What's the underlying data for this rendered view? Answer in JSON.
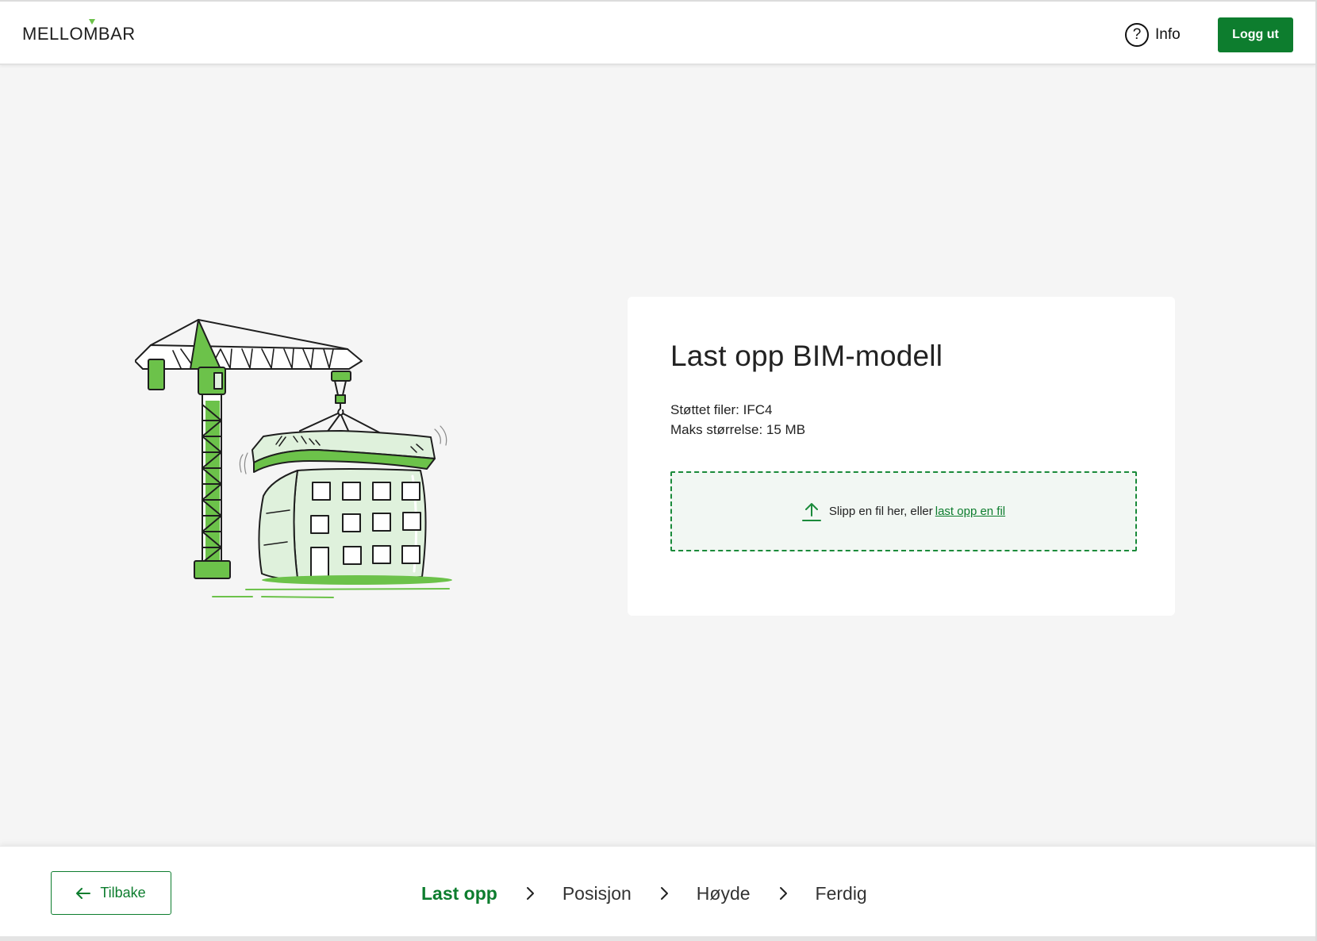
{
  "header": {
    "logo": "MELLOMBAR",
    "info_label": "Info",
    "logout_label": "Logg ut"
  },
  "card": {
    "title": "Last opp BIM-modell",
    "supported_files": "Støttet filer: IFC4",
    "max_size": "Maks størrelse: 15 MB",
    "dropzone_text": "Slipp en fil her, eller",
    "dropzone_link": "last opp en fil"
  },
  "footer": {
    "back_label": "Tilbake",
    "steps": [
      {
        "label": "Last opp",
        "active": true
      },
      {
        "label": "Posisjon",
        "active": false
      },
      {
        "label": "Høyde",
        "active": false
      },
      {
        "label": "Ferdig",
        "active": false
      }
    ]
  },
  "colors": {
    "brand_green": "#0d7d2e",
    "light_green": "#6cc24a",
    "pale_green": "#dff1dc",
    "background": "#f5f5f5"
  },
  "icons": {
    "info": "question-circle-icon",
    "upload": "upload-icon",
    "back": "arrow-left-icon",
    "step_separator": "chevron-right-icon"
  }
}
